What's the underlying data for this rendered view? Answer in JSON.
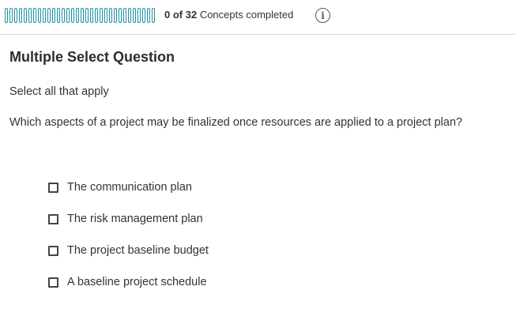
{
  "progress": {
    "completed": 0,
    "total": 32,
    "count_text": "0 of 32",
    "label": "Concepts completed",
    "info_icon": "info-icon"
  },
  "question": {
    "type_title": "Multiple Select Question",
    "instruction": "Select all that apply",
    "prompt": "Which aspects of a project may be finalized once resources are applied to a project plan?",
    "options": [
      {
        "label": "The communication plan",
        "checked": false
      },
      {
        "label": "The risk management plan",
        "checked": false
      },
      {
        "label": "The project baseline budget",
        "checked": false
      },
      {
        "label": "A baseline project schedule",
        "checked": false
      }
    ]
  },
  "colors": {
    "accent": "#1b8fa3",
    "text": "#333333",
    "divider": "#d9d9d9"
  }
}
